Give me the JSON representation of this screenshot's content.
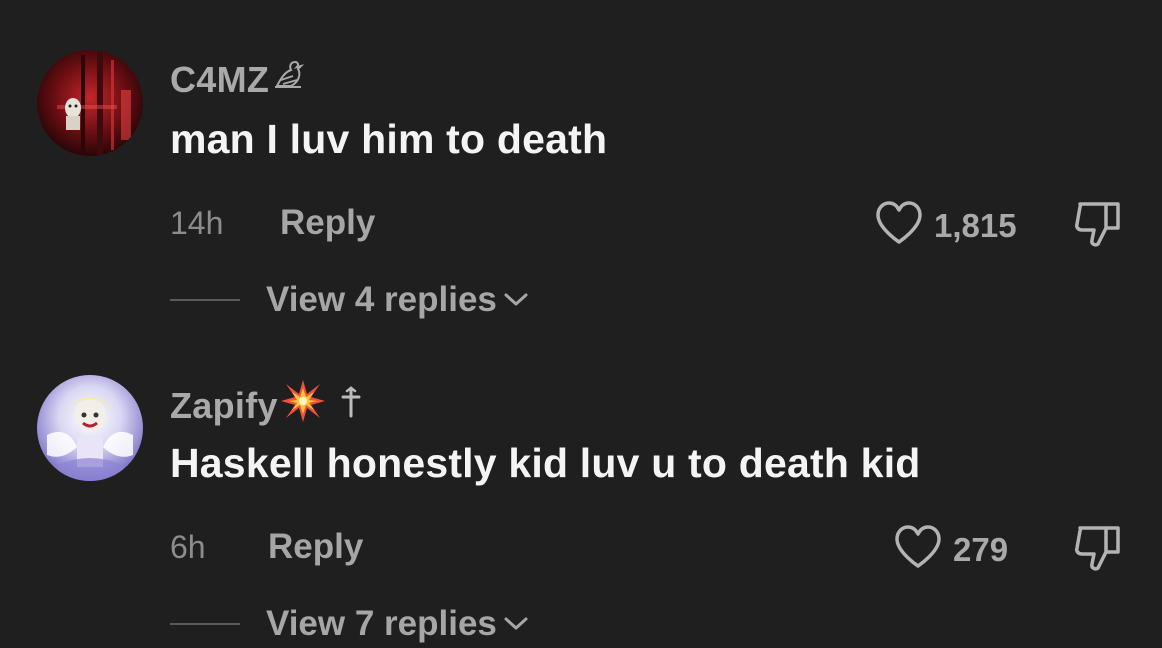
{
  "comments": [
    {
      "username": "C4MZ",
      "badge_icon": "bird-icon",
      "text": "man I luv him to death",
      "time": "14h",
      "reply_label": "Reply",
      "likes": "1,815",
      "view_replies_label": "View 4 replies"
    },
    {
      "username": "Zapify",
      "badge_icon": "collision-emoji-icon",
      "badge_icon_2": "cross-icon",
      "text": "Haskell honestly kid luv u to death kid",
      "time": "6h",
      "reply_label": "Reply",
      "likes": "279",
      "view_replies_label": "View 7 replies"
    }
  ],
  "colors": {
    "background": "#1f1f1f",
    "username": "#a9a9a9",
    "comment_text": "#f4f4f4",
    "meta": "#8c8c8c"
  }
}
